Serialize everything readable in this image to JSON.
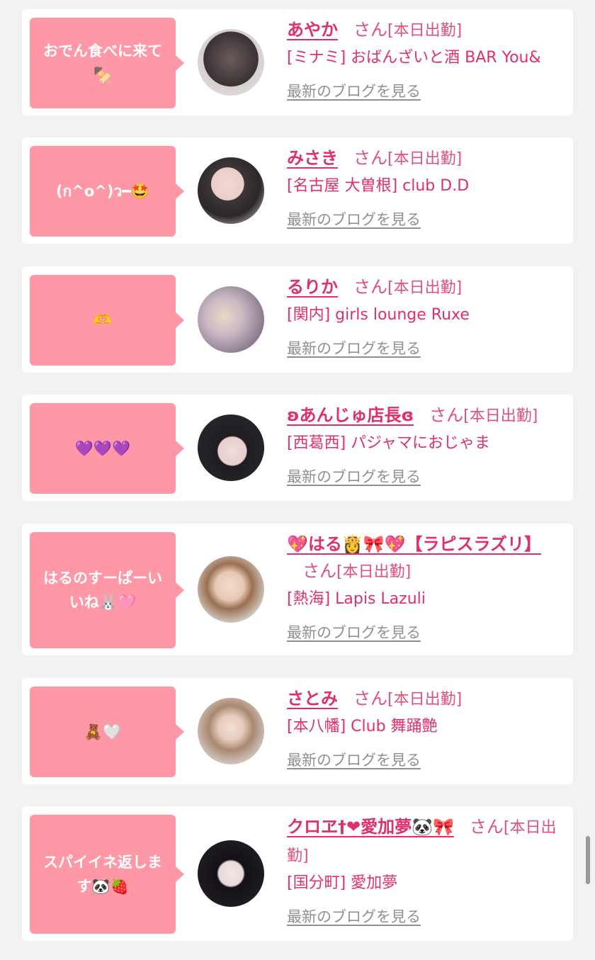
{
  "entries": [
    {
      "message": "おでん食べに来て🍢",
      "name": "あやか",
      "suffix": "さん",
      "status": "[本日出勤]",
      "shop": "[ミナミ] おばんざいと酒 BAR You&",
      "blog": "最新のブログを見る",
      "avatar_color": "#3a3234"
    },
    {
      "message": "(ก^o^)ว━🤩",
      "name": "みさき",
      "suffix": "さん",
      "status": "[本日出勤]",
      "shop": "[名古屋 大曽根] club D.D",
      "blog": "最新のブログを見る",
      "avatar_color": "#d8cfcd"
    },
    {
      "message": "🫶",
      "name": "るりか",
      "suffix": "さん",
      "status": "[本日出勤]",
      "shop": "[関内] girls lounge Ruxe",
      "blog": "最新のブログを見る",
      "avatar_color": "#a89aa6"
    },
    {
      "message": "💜💜💜",
      "name": "ʚあんじゅ店長ɞ",
      "suffix": "さん",
      "status": "[本日出勤]",
      "shop": "[西葛西] パジャマにおじゃま",
      "blog": "最新のブログを見る",
      "avatar_color": "#2b2a30"
    },
    {
      "message": "はるのすーぱーいいね🐰🩷",
      "name": "💖はる👸🎀💖【ラピスラズリ】",
      "suffix": "さん",
      "status": "[本日出勤]",
      "shop": "[熱海] Lapis Lazuli",
      "blog": "最新のブログを見る",
      "avatar_color": "#c9a58a"
    },
    {
      "message": "🧸🤍",
      "name": "さとみ",
      "suffix": "さん",
      "status": "[本日出勤]",
      "shop": "[本八幡] Club 舞踊艶",
      "blog": "最新のブログを見る",
      "avatar_color": "#b79a86"
    },
    {
      "message": "スパイイネ返します🐼🍓",
      "name": "クロヱ†❤愛加夢🐼🎀",
      "suffix": "さん",
      "status": "[本日出勤]",
      "shop": "[国分町] 愛加夢",
      "blog": "最新のブログを見る",
      "avatar_color": "#1e1b20"
    }
  ],
  "colors": {
    "bubble": "#ff98a6",
    "name": "#e0306a",
    "link": "#909090",
    "background": "#f2f2f2"
  }
}
